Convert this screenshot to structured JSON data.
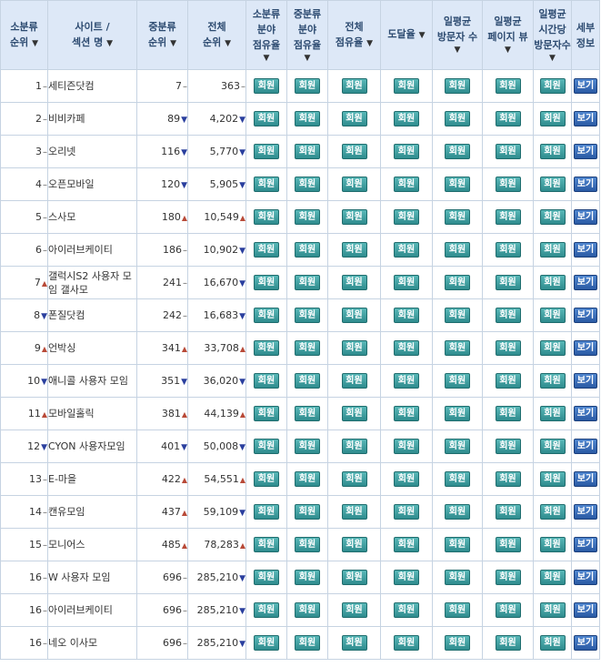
{
  "headers": [
    {
      "lines": [
        "소분류",
        "순위"
      ],
      "sort": "▼",
      "inline": true
    },
    {
      "lines": [
        "사이트 /",
        "섹션 명"
      ],
      "sort": "▼",
      "inline": true
    },
    {
      "lines": [
        "중분류",
        "순위"
      ],
      "sort": "▼",
      "inline": true
    },
    {
      "lines": [
        "전체",
        "순위"
      ],
      "sort": "▼",
      "inline": true
    },
    {
      "lines": [
        "소분류",
        "분야",
        "점유율"
      ],
      "sort": "▼",
      "inline": false
    },
    {
      "lines": [
        "중분류",
        "분야",
        "점유율"
      ],
      "sort": "▼",
      "inline": false
    },
    {
      "lines": [
        "전체",
        "점유율"
      ],
      "sort": "▼",
      "inline": true
    },
    {
      "lines": [
        "도달율"
      ],
      "sort": "▼",
      "inline": true
    },
    {
      "lines": [
        "일평균",
        "방문자 수"
      ],
      "sort": "▼",
      "inline": false
    },
    {
      "lines": [
        "일평균",
        "페이지 뷰"
      ],
      "sort": "▼",
      "inline": false
    },
    {
      "lines": [
        "일평균",
        "시간당",
        "방문자수"
      ],
      "sort": "▼",
      "inline": false
    },
    {
      "lines": [
        "세부",
        "정보"
      ],
      "sort": "",
      "inline": false
    }
  ],
  "member_label": "회원",
  "view_label": "보기",
  "colors": {
    "header_bg": "#dde8f7",
    "border": "#c6d3e2",
    "up": "#b84a38",
    "down": "#2a3f9e",
    "member_btn": "#3a9a9c",
    "view_btn": "#2f62ad"
  },
  "rows": [
    {
      "rank": "1",
      "rank_change": "same",
      "site": "세티즌닷컴",
      "mid": "7",
      "mid_change": "same",
      "total": "363",
      "total_change": "same"
    },
    {
      "rank": "2",
      "rank_change": "same",
      "site": "비비카페",
      "mid": "89",
      "mid_change": "down",
      "total": "4,202",
      "total_change": "down"
    },
    {
      "rank": "3",
      "rank_change": "same",
      "site": "오리넷",
      "mid": "116",
      "mid_change": "down",
      "total": "5,770",
      "total_change": "down"
    },
    {
      "rank": "4",
      "rank_change": "same",
      "site": "오픈모바일",
      "mid": "120",
      "mid_change": "down",
      "total": "5,905",
      "total_change": "down"
    },
    {
      "rank": "5",
      "rank_change": "same",
      "site": "스사모",
      "mid": "180",
      "mid_change": "up",
      "total": "10,549",
      "total_change": "up"
    },
    {
      "rank": "6",
      "rank_change": "same",
      "site": "아이러브케이티",
      "mid": "186",
      "mid_change": "same",
      "total": "10,902",
      "total_change": "down"
    },
    {
      "rank": "7",
      "rank_change": "up",
      "site": "갤럭시S2 사용자 모임 갤사모",
      "mid": "241",
      "mid_change": "same",
      "total": "16,670",
      "total_change": "down"
    },
    {
      "rank": "8",
      "rank_change": "down",
      "site": "폰질닷컴",
      "mid": "242",
      "mid_change": "same",
      "total": "16,683",
      "total_change": "down"
    },
    {
      "rank": "9",
      "rank_change": "up",
      "site": "언박싱",
      "mid": "341",
      "mid_change": "up",
      "total": "33,708",
      "total_change": "up"
    },
    {
      "rank": "10",
      "rank_change": "down",
      "site": "애니콜 사용자 모임",
      "mid": "351",
      "mid_change": "down",
      "total": "36,020",
      "total_change": "down"
    },
    {
      "rank": "11",
      "rank_change": "up",
      "site": "모바일홀릭",
      "mid": "381",
      "mid_change": "up",
      "total": "44,139",
      "total_change": "up"
    },
    {
      "rank": "12",
      "rank_change": "down",
      "site": "CYON 사용자모임",
      "mid": "401",
      "mid_change": "down",
      "total": "50,008",
      "total_change": "down"
    },
    {
      "rank": "13",
      "rank_change": "same",
      "site": "E-마을",
      "mid": "422",
      "mid_change": "up",
      "total": "54,551",
      "total_change": "up"
    },
    {
      "rank": "14",
      "rank_change": "same",
      "site": "캔유모임",
      "mid": "437",
      "mid_change": "up",
      "total": "59,109",
      "total_change": "down"
    },
    {
      "rank": "15",
      "rank_change": "same",
      "site": "모니어스",
      "mid": "485",
      "mid_change": "up",
      "total": "78,283",
      "total_change": "up"
    },
    {
      "rank": "16",
      "rank_change": "same",
      "site": "W 사용자 모임",
      "mid": "696",
      "mid_change": "same",
      "total": "285,210",
      "total_change": "down"
    },
    {
      "rank": "16",
      "rank_change": "same",
      "site": "아이러브케이티",
      "mid": "696",
      "mid_change": "same",
      "total": "285,210",
      "total_change": "down"
    },
    {
      "rank": "16",
      "rank_change": "same",
      "site": "네오 이사모",
      "mid": "696",
      "mid_change": "same",
      "total": "285,210",
      "total_change": "down"
    }
  ]
}
